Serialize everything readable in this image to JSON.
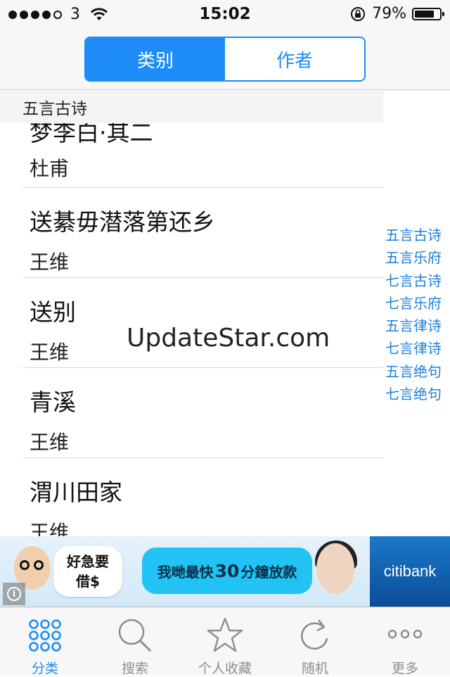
{
  "status_bar": {
    "carrier": "3",
    "time": "15:02",
    "battery_text": "79%",
    "battery_level": 0.79
  },
  "segmented": {
    "tabs": [
      {
        "label": "类别",
        "active": true
      },
      {
        "label": "作者",
        "active": false
      }
    ]
  },
  "section_header": "五言古诗",
  "list": [
    {
      "title": "梦李白·其二",
      "author": "杜甫"
    },
    {
      "title": "送綦毋潜落第还乡",
      "author": "王维"
    },
    {
      "title": "送别",
      "author": "王维"
    },
    {
      "title": "青溪",
      "author": "王维"
    },
    {
      "title": "渭川田家",
      "author": "王维"
    }
  ],
  "index": [
    "五言古诗",
    "五言乐府",
    "七言古诗",
    "七言乐府",
    "五言律诗",
    "七言律诗",
    "五言绝句",
    "七言绝句"
  ],
  "watermark": "UpdateStar.com",
  "ad": {
    "bubble_left": [
      "好急要",
      "借$"
    ],
    "bubble_main_pre": "我哋最快",
    "bubble_main_num": "30",
    "bubble_main_post": "分鐘放款",
    "brand": "citibank"
  },
  "tabbar": {
    "tabs": [
      {
        "label": "分类",
        "icon": "grid-dots-icon",
        "active": true
      },
      {
        "label": "搜索",
        "icon": "search-icon",
        "active": false
      },
      {
        "label": "个人收藏",
        "icon": "star-icon",
        "active": false
      },
      {
        "label": "随机",
        "icon": "refresh-icon",
        "active": false
      },
      {
        "label": "更多",
        "icon": "more-dots-icon",
        "active": false
      }
    ]
  },
  "colors": {
    "accent": "#1d8cf6",
    "index_text": "#1d7fdb",
    "ad_cyan": "#20c3f4",
    "citi_blue": "#0b4c96"
  }
}
